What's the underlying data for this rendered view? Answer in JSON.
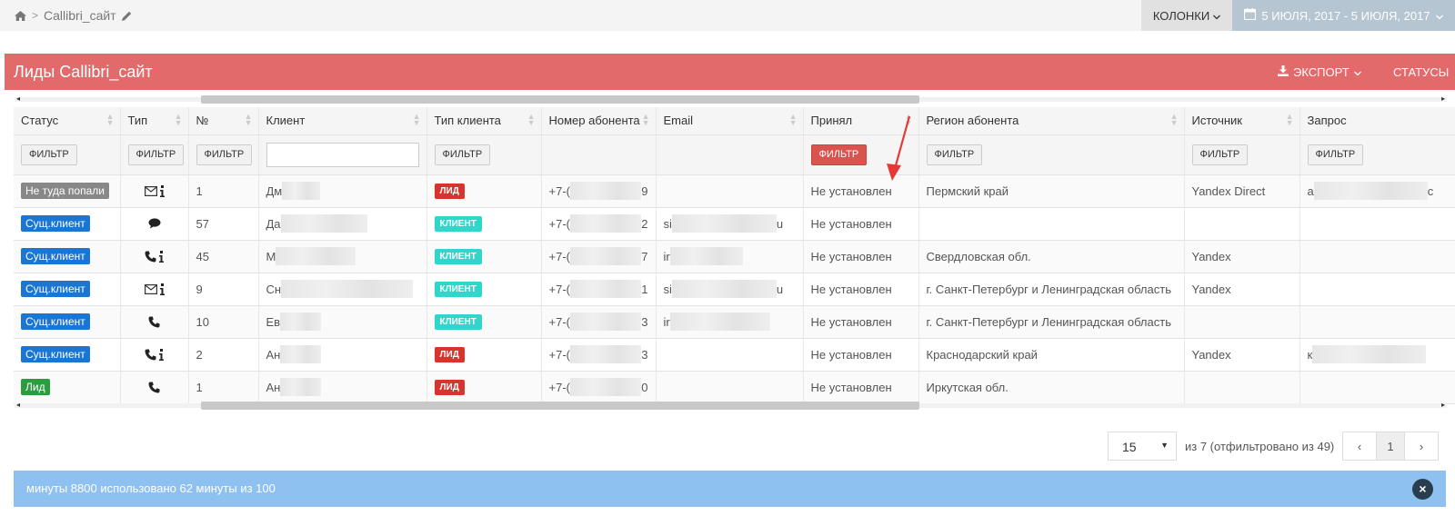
{
  "breadcrumb": {
    "home_icon": "home-icon",
    "separator": ">",
    "title": "Callibri_сайт",
    "edit_icon": "pencil-icon"
  },
  "toolbar": {
    "columns_label": "КОЛОНКИ",
    "date_range_label": "5 ИЮЛЯ, 2017 - 5 ИЮЛЯ, 2017",
    "calendar_icon": "calendar-icon"
  },
  "panel": {
    "title": "Лиды Callibri_сайт",
    "export_label": "ЭКСПОРТ",
    "statuses_label": "СТАТУСЫ"
  },
  "colors": {
    "header_red": "#e26a6a",
    "badge_blue": "#1a76d2",
    "badge_green": "#2a9d3f",
    "badge_gray": "#888888",
    "tag_red": "#d9342b",
    "tag_teal": "#2ed6cc",
    "alert_blue": "#8fc1f0"
  },
  "table": {
    "columns": [
      "Статус",
      "Тип",
      "№",
      "Клиент",
      "Тип клиента",
      "Номер абонента",
      "Email",
      "Принял",
      "Регион абонента",
      "Источник",
      "Запрос"
    ],
    "filter_label": "ФИЛЬТР",
    "rows": [
      {
        "status": "Не туда попали",
        "status_color": "gray",
        "type_icons": [
          "mail-icon",
          "info-icon"
        ],
        "num": "1",
        "client": "Дм",
        "client_type": "ЛИД",
        "client_type_color": "red",
        "phone_start": "+7-(",
        "phone_end": "9",
        "email_start": "",
        "email_end": "",
        "accepted": "Не установлен",
        "region": "Пермский край",
        "source": "Yandex Direct",
        "query_start": "а",
        "query_end": "с"
      },
      {
        "status": "Сущ.клиент",
        "status_color": "blue",
        "type_icons": [
          "chat-icon"
        ],
        "num": "57",
        "client": "Да",
        "client_type": "КЛИЕНТ",
        "client_type_color": "teal",
        "phone_start": "+7-(",
        "phone_end": "2",
        "email_start": "si",
        "email_end": "u",
        "accepted": "Не установлен",
        "region": "",
        "source": "",
        "query_start": "",
        "query_end": ""
      },
      {
        "status": "Сущ.клиент",
        "status_color": "blue",
        "type_icons": [
          "phone-icon",
          "info-icon"
        ],
        "num": "45",
        "client": "М",
        "client_type": "КЛИЕНТ",
        "client_type_color": "teal",
        "phone_start": "+7-(",
        "phone_end": "7",
        "email_start": "ir",
        "email_end": "",
        "accepted": "Не установлен",
        "region": "Свердловская обл.",
        "source": "Yandex",
        "query_start": "",
        "query_end": ""
      },
      {
        "status": "Сущ.клиент",
        "status_color": "blue",
        "type_icons": [
          "mail-icon",
          "info-icon"
        ],
        "num": "9",
        "client": "Сн",
        "client_type": "КЛИЕНТ",
        "client_type_color": "teal",
        "phone_start": "+7-(",
        "phone_end": "1",
        "email_start": "si",
        "email_end": "u",
        "accepted": "Не установлен",
        "region": "г. Санкт-Петербург и Ленинградская область",
        "source": "Yandex",
        "query_start": "",
        "query_end": ""
      },
      {
        "status": "Сущ.клиент",
        "status_color": "blue",
        "type_icons": [
          "phone-icon"
        ],
        "num": "10",
        "client": "Ев",
        "client_type": "КЛИЕНТ",
        "client_type_color": "teal",
        "phone_start": "+7-(",
        "phone_end": "3",
        "email_start": "ir",
        "email_end": "",
        "accepted": "Не установлен",
        "region": "г. Санкт-Петербург и Ленинградская область",
        "source": "",
        "query_start": "",
        "query_end": ""
      },
      {
        "status": "Сущ.клиент",
        "status_color": "blue",
        "type_icons": [
          "phone-icon",
          "info-icon"
        ],
        "num": "2",
        "client": "Ан",
        "client_type": "ЛИД",
        "client_type_color": "red",
        "phone_start": "+7-(",
        "phone_end": "3",
        "email_start": "",
        "email_end": "",
        "accepted": "Не установлен",
        "region": "Краснодарский край",
        "source": "Yandex",
        "query_start": "к",
        "query_end": ""
      },
      {
        "status": "Лид",
        "status_color": "green",
        "type_icons": [
          "phone-icon"
        ],
        "num": "1",
        "client": "Ан",
        "client_type": "ЛИД",
        "client_type_color": "red",
        "phone_start": "+7-(",
        "phone_end": "0",
        "email_start": "",
        "email_end": "",
        "accepted": "Не установлен",
        "region": "Иркутская обл.",
        "source": "",
        "query_start": "",
        "query_end": ""
      }
    ]
  },
  "pagination": {
    "page_size": "15",
    "info": "из 7 (отфильтровано из 49)",
    "prev": "‹",
    "current_page": "1",
    "next": "›"
  },
  "alert": {
    "text": "минуты 8800 использовано 62 минуты из 100",
    "close_label": "×"
  }
}
